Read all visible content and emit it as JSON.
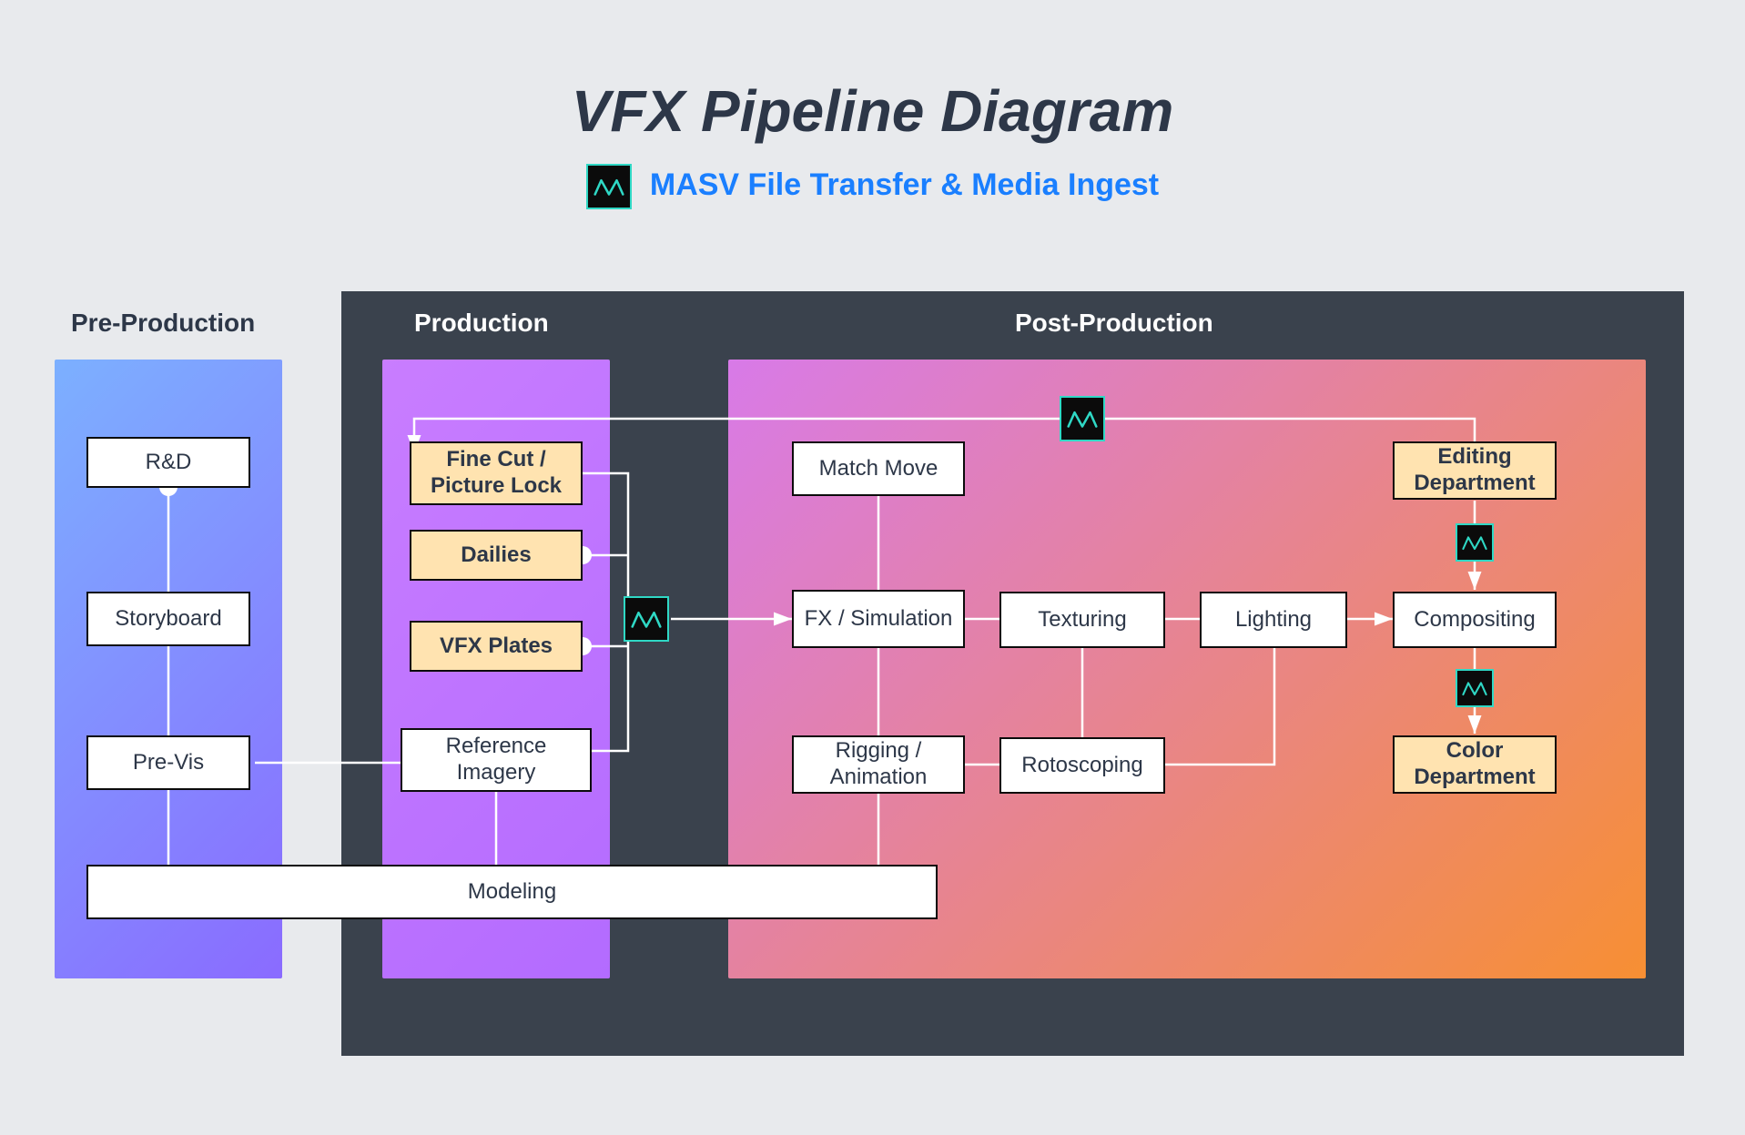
{
  "title": "VFX Pipeline Diagram",
  "subtitle": "MASV File Transfer & Media Ingest",
  "sections": {
    "pre": "Pre-Production",
    "prod": "Production",
    "post": "Post-Production"
  },
  "nodes": {
    "rd": "R&D",
    "storyboard": "Storyboard",
    "previs": "Pre-Vis",
    "finecut": "Fine Cut / Picture Lock",
    "dailies": "Dailies",
    "vfxplates": "VFX Plates",
    "refimg": "Reference Imagery",
    "modeling": "Modeling",
    "matchmove": "Match Move",
    "fxsim": "FX / Simulation",
    "rigging": "Rigging / Animation",
    "texturing": "Texturing",
    "rotoscoping": "Rotoscoping",
    "lighting": "Lighting",
    "editing": "Editing Department",
    "compositing": "Compositing",
    "color": "Color Department"
  },
  "icons": {
    "masv": "masv-logo"
  }
}
